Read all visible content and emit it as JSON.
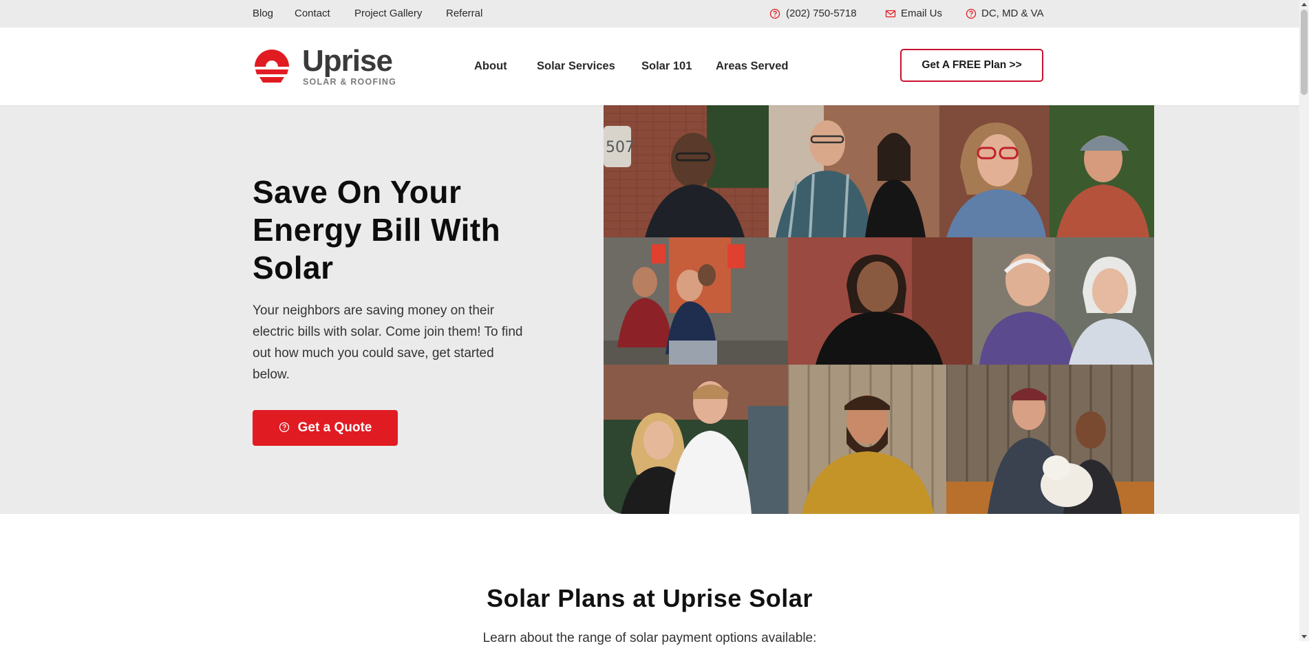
{
  "topbar": {
    "links": [
      "Blog",
      "Contact",
      "Project Gallery",
      "Referral"
    ],
    "phone": "(202) 750-5718",
    "email": "Email Us",
    "region": "DC, MD & VA"
  },
  "header": {
    "logo_word": "Uprise",
    "logo_tagline": "SOLAR & ROOFING",
    "nav": [
      "About",
      "Solar Services",
      "Solar 101",
      "Areas Served"
    ],
    "cta": "Get A FREE Plan >>"
  },
  "hero": {
    "title": "Save On Your Energy Bill With Solar",
    "subtitle": "Your neighbors are saving money on their electric bills with solar. Come join them! To find out how much you could save, get started below.",
    "button": "Get a Quote",
    "house_number": "507"
  },
  "plans": {
    "title": "Solar Plans at Uprise Solar",
    "subtitle": "Learn about the range of solar payment options available:"
  },
  "colors": {
    "brand_red": "#e11b22",
    "outline_red": "#c8102e",
    "hero_bg": "#ebebeb"
  },
  "icons": {
    "phone": "question-circle-icon",
    "email": "envelope-icon",
    "region": "question-circle-icon",
    "quote_button": "question-circle-icon"
  }
}
